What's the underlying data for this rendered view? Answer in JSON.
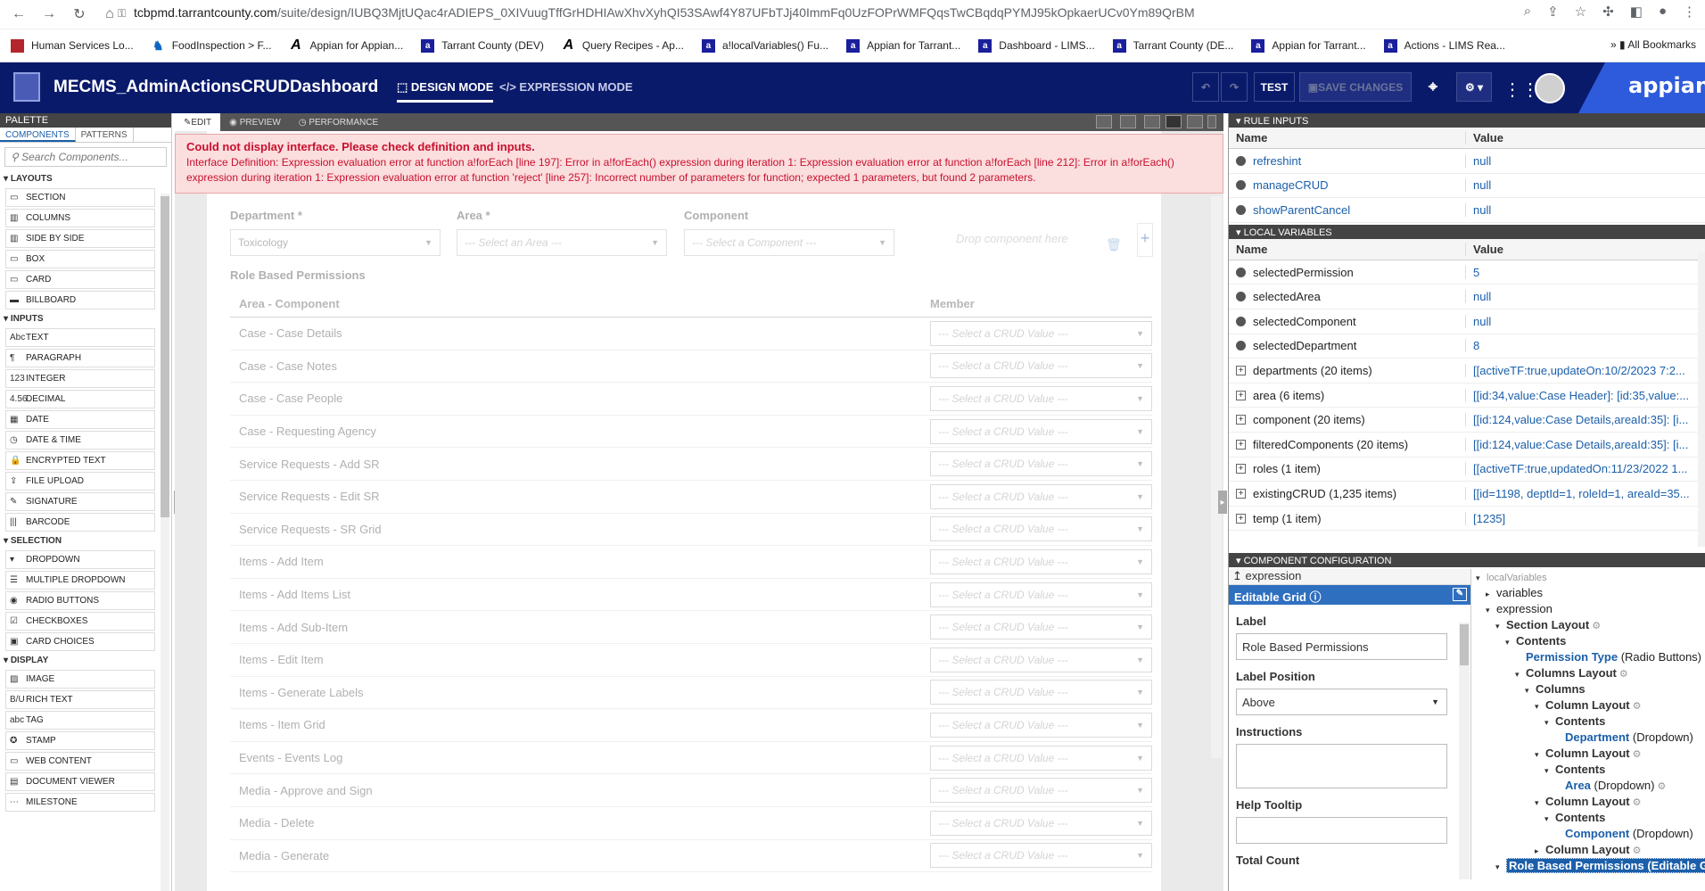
{
  "browser": {
    "host": "tcbpmd.tarrantcounty.com",
    "path": "/suite/design/IUBQ3MjtUQac4rADIEPS_0XIVuugTffGrHDHIAwXhvXyhQI53SAwf4Y87UFbTJj40ImmFq0UzFOPrWMFQqsTwCBqdqPYMJ95kOpkaerUCv0Ym89QrBM"
  },
  "bookmarks": [
    {
      "label": "Human Services Lo...",
      "icon": "hs"
    },
    {
      "label": "FoodInspection > F...",
      "icon": "fo"
    },
    {
      "label": "Appian for Appian...",
      "icon": "a"
    },
    {
      "label": "Tarrant County (DEV)",
      "icon": "ap"
    },
    {
      "label": "Query Recipes - Ap...",
      "icon": "a"
    },
    {
      "label": "a!localVariables() Fu...",
      "icon": "ap"
    },
    {
      "label": "Appian for Tarrant...",
      "icon": "ap"
    },
    {
      "label": "Dashboard - LIMS...",
      "icon": "ap"
    },
    {
      "label": "Tarrant County (DE...",
      "icon": "ap"
    },
    {
      "label": "Appian for Tarrant...",
      "icon": "ap"
    },
    {
      "label": "Actions - LIMS Rea...",
      "icon": "ap"
    }
  ],
  "all_bookmarks": "All Bookmarks",
  "app": {
    "title": "MECMS_AdminActionsCRUDDashboard",
    "design_mode": "DESIGN MODE",
    "expression_mode": "EXPRESSION MODE",
    "test": "TEST",
    "save": "SAVE CHANGES",
    "logo": "appian"
  },
  "palette": {
    "title": "PALETTE",
    "tab_components": "COMPONENTS",
    "tab_patterns": "PATTERNS",
    "search_placeholder": "Search Components...",
    "sections": [
      {
        "name": "LAYOUTS",
        "items": [
          {
            "i": "▭",
            "l": "SECTION"
          },
          {
            "i": "▥",
            "l": "COLUMNS"
          },
          {
            "i": "▥",
            "l": "SIDE BY SIDE"
          },
          {
            "i": "▭",
            "l": "BOX"
          },
          {
            "i": "▭",
            "l": "CARD"
          },
          {
            "i": "▬",
            "l": "BILLBOARD"
          }
        ]
      },
      {
        "name": "INPUTS",
        "items": [
          {
            "i": "Abc",
            "l": "TEXT"
          },
          {
            "i": "¶",
            "l": "PARAGRAPH"
          },
          {
            "i": "123",
            "l": "INTEGER"
          },
          {
            "i": "4.56",
            "l": "DECIMAL"
          },
          {
            "i": "▦",
            "l": "DATE"
          },
          {
            "i": "◷",
            "l": "DATE & TIME"
          },
          {
            "i": "🔒",
            "l": "ENCRYPTED TEXT"
          },
          {
            "i": "⇪",
            "l": "FILE UPLOAD"
          },
          {
            "i": "✎",
            "l": "SIGNATURE"
          },
          {
            "i": "|||",
            "l": "BARCODE"
          }
        ]
      },
      {
        "name": "SELECTION",
        "items": [
          {
            "i": "▾",
            "l": "DROPDOWN"
          },
          {
            "i": "☰",
            "l": "MULTIPLE DROPDOWN"
          },
          {
            "i": "◉",
            "l": "RADIO BUTTONS"
          },
          {
            "i": "☑",
            "l": "CHECKBOXES"
          },
          {
            "i": "▣",
            "l": "CARD CHOICES"
          }
        ]
      },
      {
        "name": "DISPLAY",
        "items": [
          {
            "i": "▨",
            "l": "IMAGE"
          },
          {
            "i": "B/U",
            "l": "RICH TEXT"
          },
          {
            "i": "abc",
            "l": "TAG"
          },
          {
            "i": "✪",
            "l": "STAMP"
          },
          {
            "i": "▭",
            "l": "WEB CONTENT"
          },
          {
            "i": "▤",
            "l": "DOCUMENT VIEWER"
          },
          {
            "i": "⋯",
            "l": "MILESTONE"
          }
        ]
      }
    ]
  },
  "canvas": {
    "tabs": [
      "EDIT",
      "PREVIEW",
      "PERFORMANCE"
    ]
  },
  "error": {
    "title": "Could not display interface. Please check definition and inputs.",
    "body": "Interface Definition: Expression evaluation error at function a!forEach [line 197]: Error in a!forEach() expression during iteration 1: Expression evaluation error at function a!forEach [line 212]: Error in a!forEach() expression during iteration 1: Expression evaluation error at function 'reject' [line 257]: Incorrect number of parameters for function; expected 1 parameters, but found 2 parameters."
  },
  "form": {
    "department_label": "Department *",
    "department_value": "Toxicology",
    "area_label": "Area *",
    "area_placeholder": "--- Select an Area ---",
    "component_label": "Component",
    "component_placeholder": "--- Select a Component ---",
    "drop_text": "Drop component here",
    "grid_label": "Role Based Permissions",
    "col1": "Area - Component",
    "col2": "Member",
    "select_placeholder": "--- Select a CRUD Value ---",
    "rows": [
      "Case - Case Details",
      "Case - Case Notes",
      "Case - Case People",
      "Case - Requesting Agency",
      "Service Requests - Add SR",
      "Service Requests - Edit SR",
      "Service Requests - SR Grid",
      "Items - Add Item",
      "Items - Add Items List",
      "Items - Add Sub-Item",
      "Items - Edit Item",
      "Items - Generate Labels",
      "Items - Item Grid",
      "Events - Events Log",
      "Media - Approve and Sign",
      "Media - Delete",
      "Media - Generate"
    ]
  },
  "rule_inputs": {
    "title": "RULE INPUTS",
    "col_name": "Name",
    "col_value": "Value",
    "rows": [
      {
        "name": "refreshint",
        "value": "null"
      },
      {
        "name": "manageCRUD",
        "value": "null"
      },
      {
        "name": "showParentCancel",
        "value": "null"
      }
    ]
  },
  "local_vars": {
    "title": "LOCAL VARIABLES",
    "col_name": "Name",
    "col_value": "Value",
    "rows": [
      {
        "name": "selectedPermission",
        "value": "5",
        "exp": false,
        "vc": "blue"
      },
      {
        "name": "selectedArea",
        "value": "null",
        "exp": false,
        "vc": "blue"
      },
      {
        "name": "selectedComponent",
        "value": "null",
        "exp": false,
        "vc": "blue"
      },
      {
        "name": "selectedDepartment",
        "value": "8",
        "exp": false,
        "vc": "blue"
      },
      {
        "name": "departments (20 items)",
        "value": "[[activeTF:true,updateOn:10/2/2023 7:2...",
        "exp": true,
        "vc": "blue"
      },
      {
        "name": "area (6 items)",
        "value": "[[id:34,value:Case Header]: [id:35,value:...",
        "exp": true,
        "vc": "blue"
      },
      {
        "name": "component (20 items)",
        "value": "[[id:124,value:Case Details,areaId:35]: [i...",
        "exp": true,
        "vc": "blue"
      },
      {
        "name": "filteredComponents (20 items)",
        "value": "[[id:124,value:Case Details,areaId:35]: [i...",
        "exp": true,
        "vc": "blue"
      },
      {
        "name": "roles (1 item)",
        "value": "[[activeTF:true,updatedOn:11/23/2022 1...",
        "exp": true,
        "vc": "blue"
      },
      {
        "name": "existingCRUD (1,235 items)",
        "value": "[[id=1198, deptId=1, roleId=1, areaId=35...",
        "exp": true,
        "vc": "blue"
      },
      {
        "name": "temp (1 item)",
        "value": "[1235]",
        "exp": true,
        "vc": "blue"
      }
    ]
  },
  "component_config": {
    "title": "COMPONENT CONFIGURATION",
    "expression": "expression",
    "component": "Editable Grid",
    "label_label": "Label",
    "label_value": "Role Based Permissions",
    "pos_label": "Label Position",
    "pos_value": "Above",
    "instr_label": "Instructions",
    "help_label": "Help Tooltip",
    "total_label": "Total Count"
  },
  "tree": [
    {
      "d": 0,
      "t": "▾",
      "text": "localVariables",
      "cls": "g"
    },
    {
      "d": 1,
      "t": "▸",
      "text": "variables",
      "cls": ""
    },
    {
      "d": 1,
      "t": "▾",
      "text": "expression",
      "cls": ""
    },
    {
      "d": 2,
      "t": "▾",
      "text": "Section Layout",
      "cls": "k",
      "gear": true
    },
    {
      "d": 3,
      "t": "▾",
      "text": "Contents",
      "cls": "k"
    },
    {
      "d": 4,
      "t": "",
      "text": "Permission Type",
      "cls": "n",
      "suffix": " (Radio Buttons)"
    },
    {
      "d": 4,
      "t": "▾",
      "text": "Columns Layout",
      "cls": "k",
      "gear": true
    },
    {
      "d": 5,
      "t": "▾",
      "text": "Columns",
      "cls": "k"
    },
    {
      "d": 6,
      "t": "▾",
      "text": "Column Layout",
      "cls": "k",
      "gear": true
    },
    {
      "d": 7,
      "t": "▾",
      "text": "Contents",
      "cls": "k"
    },
    {
      "d": 8,
      "t": "",
      "text": "Department",
      "cls": "n",
      "suffix": " (Dropdown)"
    },
    {
      "d": 6,
      "t": "▾",
      "text": "Column Layout",
      "cls": "k",
      "gear": true
    },
    {
      "d": 7,
      "t": "▾",
      "text": "Contents",
      "cls": "k"
    },
    {
      "d": 8,
      "t": "",
      "text": "Area",
      "cls": "n",
      "suffix": " (Dropdown)",
      "gear": true
    },
    {
      "d": 6,
      "t": "▾",
      "text": "Column Layout",
      "cls": "k",
      "gear": true
    },
    {
      "d": 7,
      "t": "▾",
      "text": "Contents",
      "cls": "k"
    },
    {
      "d": 8,
      "t": "",
      "text": "Component",
      "cls": "n",
      "suffix": " (Dropdown)"
    },
    {
      "d": 6,
      "t": "▸",
      "text": "Column Layout",
      "cls": "k",
      "gear": true
    },
    {
      "d": 2,
      "t": "▾",
      "text": "Role Based Permissions (Editable G",
      "cls": "sel"
    }
  ]
}
